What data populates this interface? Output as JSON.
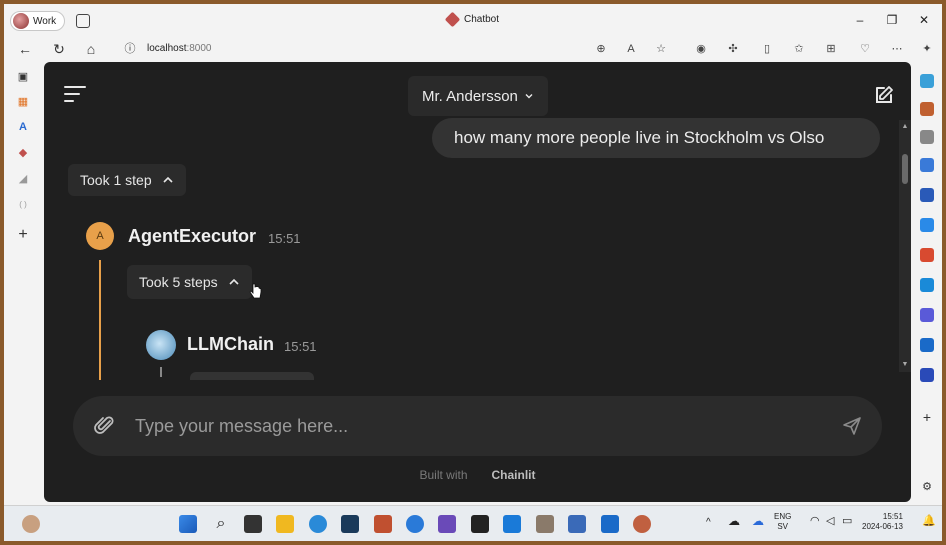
{
  "browser": {
    "profile_label": "Work",
    "tab_title": "Chatbot",
    "url_host": "localhost",
    "url_port": ":8000",
    "window_controls": [
      "–",
      "❐",
      "✕"
    ]
  },
  "header": {
    "profile_select_label": "Mr. Andersson"
  },
  "messages": {
    "user_text": "how many more people live in Stockholm vs Olso",
    "outer_step_label": "Took 1 step",
    "agent_avatar_letter": "A",
    "agent_name": "AgentExecutor",
    "agent_time": "15:51",
    "inner_step_label": "Took 5 steps",
    "llm_name": "LLMChain",
    "llm_time": "15:51"
  },
  "composer": {
    "placeholder": "Type your message here..."
  },
  "footer": {
    "built_with": "Built with",
    "brand": "Chainlit"
  },
  "taskbar": {
    "lang_top": "ENG",
    "lang_bottom": "SV",
    "time": "15:51",
    "date": "2024-06-13"
  },
  "colors": {
    "app_bg": "#1f1f1f",
    "bubble_bg": "#333333",
    "agent_accent": "#e8a04a",
    "frame_border": "#8a5a2b"
  }
}
